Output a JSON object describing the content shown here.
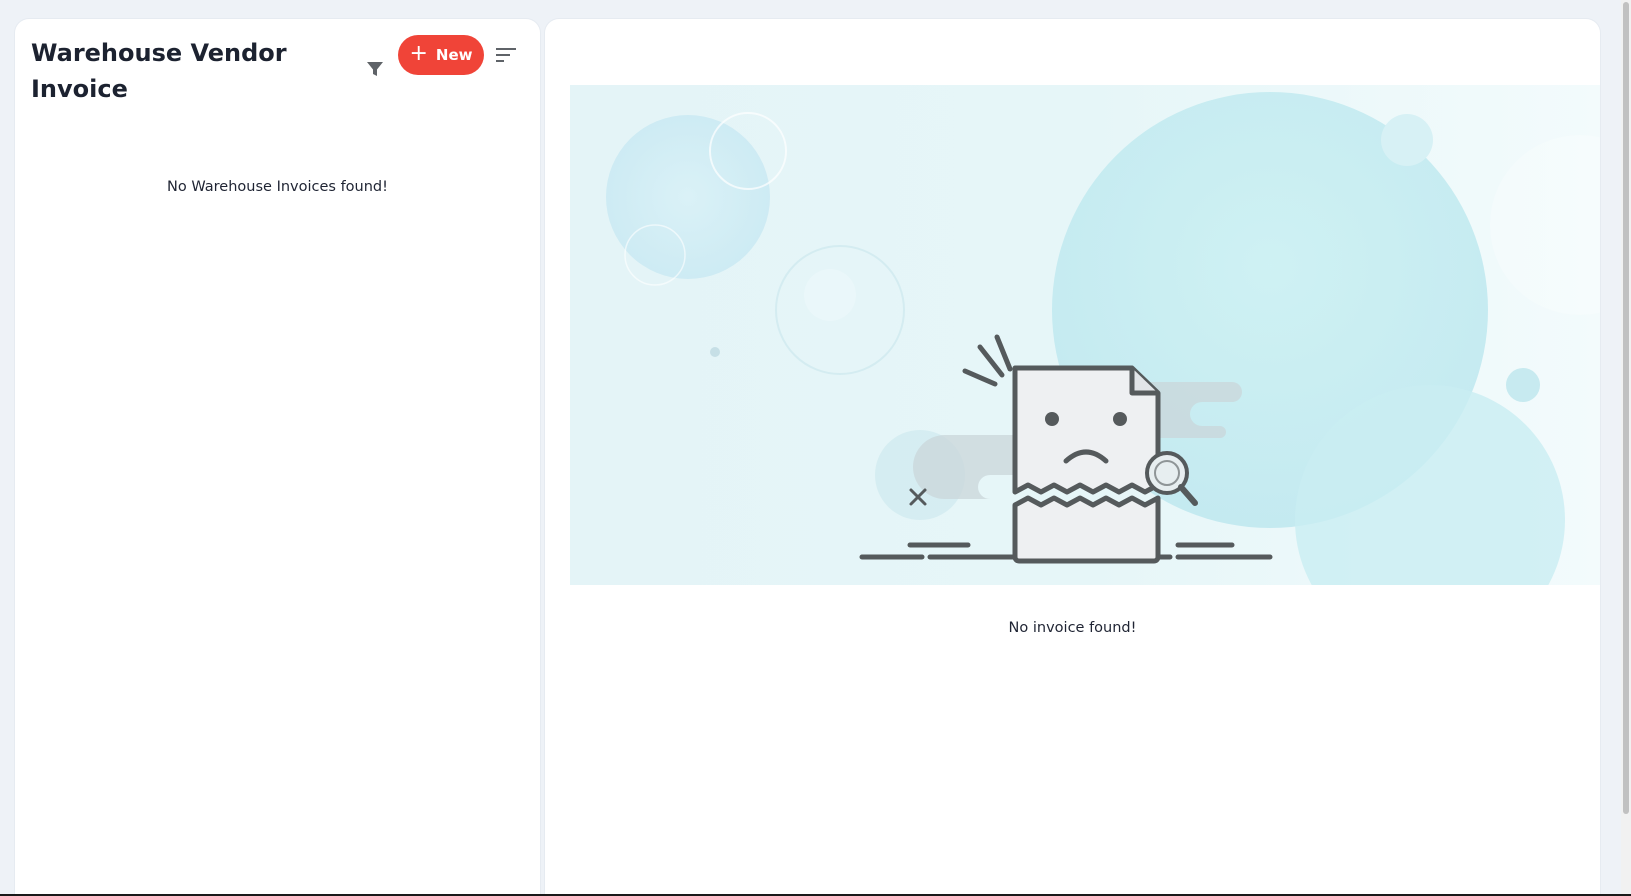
{
  "list_panel": {
    "title": "Warehouse Vendor Invoice",
    "new_button_label": "New",
    "empty_message": "No Warehouse Invoices found!"
  },
  "detail_panel": {
    "empty_message": "No invoice found!"
  },
  "icons": {
    "filter": "filter-icon",
    "new": "plus-icon",
    "sort": "sort-icon"
  },
  "colors": {
    "accent": "#f04438",
    "page_background": "#eef2f7",
    "panel_background": "#ffffff",
    "text": "#1f2433"
  }
}
